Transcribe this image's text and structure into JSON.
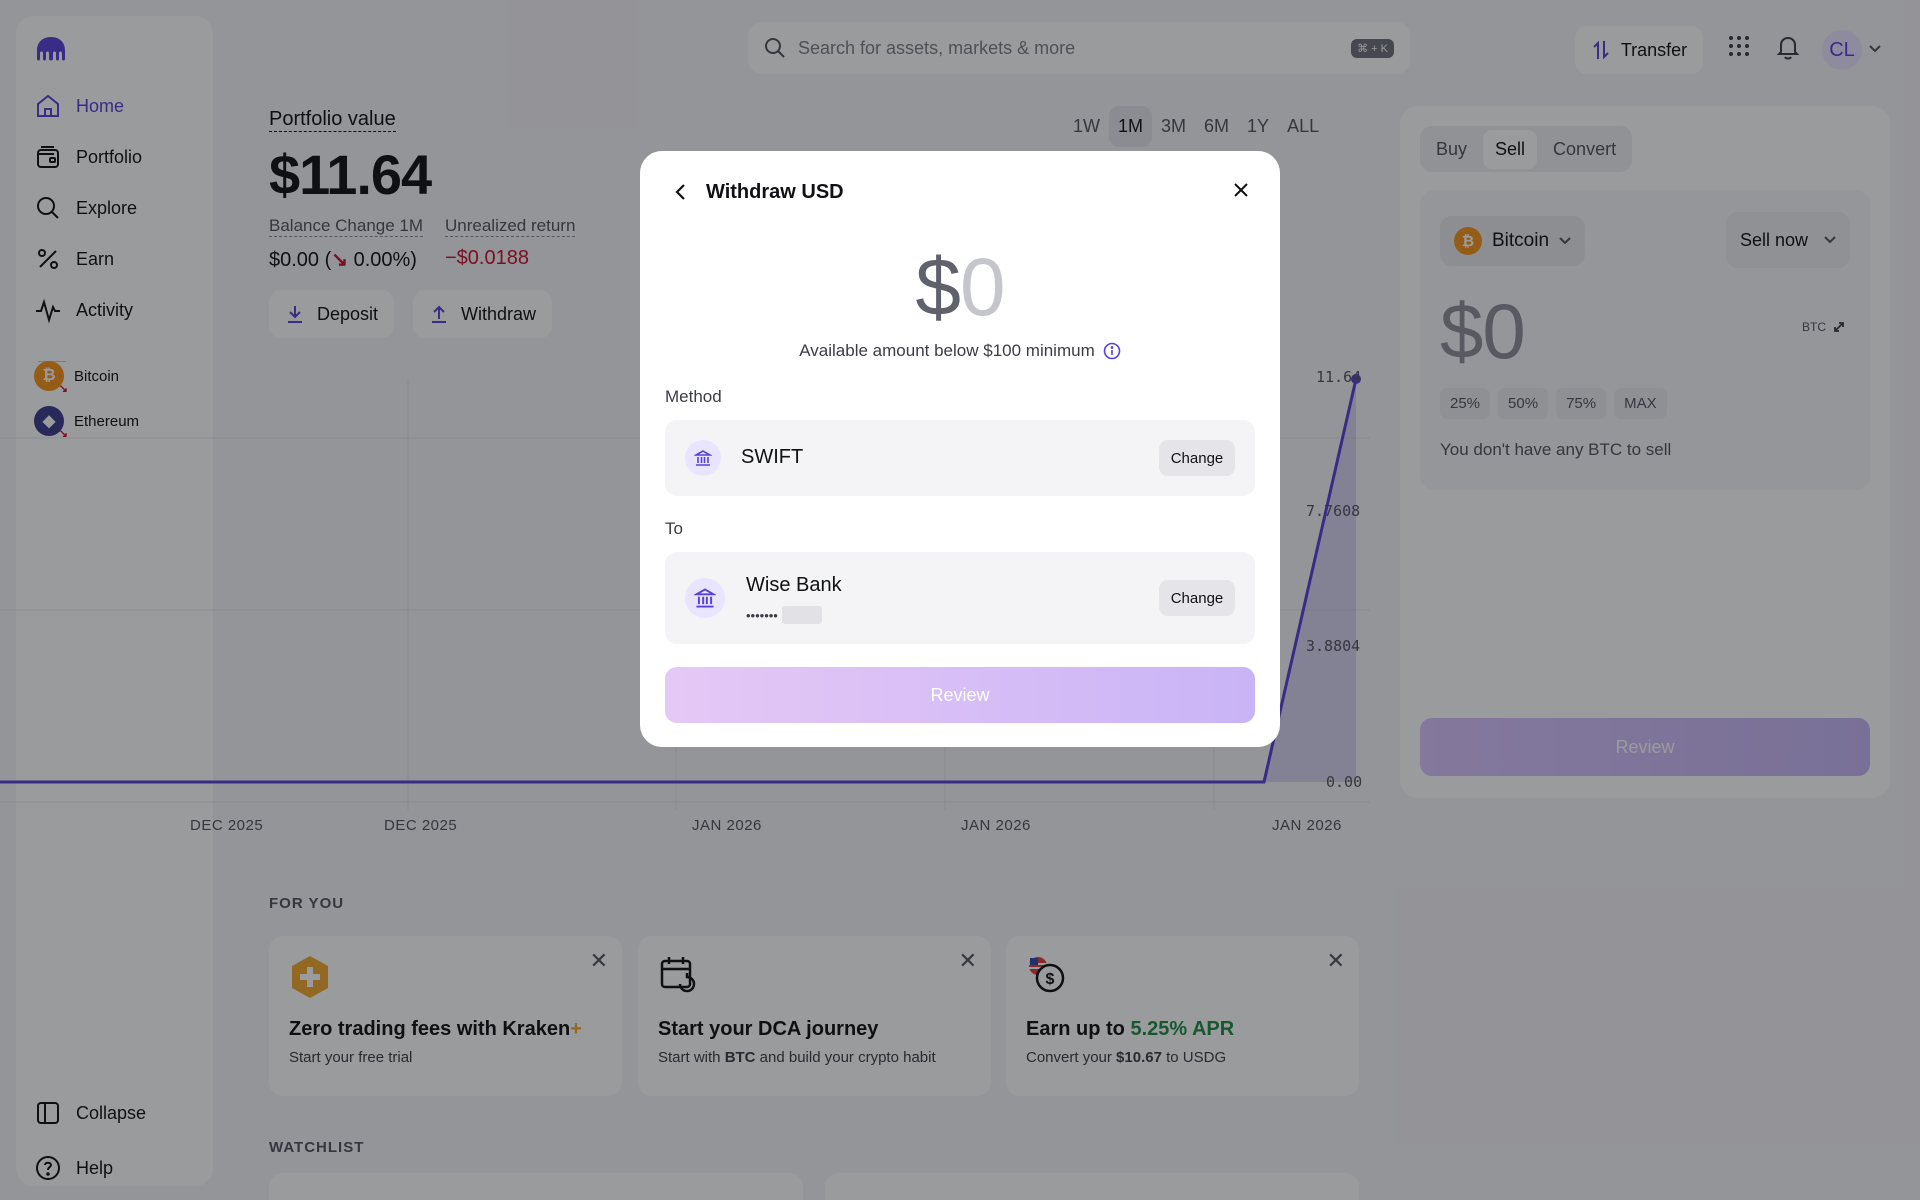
{
  "sidebar": {
    "items": [
      {
        "label": "Home",
        "icon": "home-icon"
      },
      {
        "label": "Portfolio",
        "icon": "wallet-icon"
      },
      {
        "label": "Explore",
        "icon": "search-icon"
      },
      {
        "label": "Earn",
        "icon": "percent-icon"
      },
      {
        "label": "Activity",
        "icon": "activity-icon"
      }
    ],
    "assets": [
      {
        "label": "Bitcoin",
        "color": "#f7931a"
      },
      {
        "label": "Ethereum",
        "color": "#3c3c8c"
      }
    ],
    "collapse_label": "Collapse",
    "help_label": "Help",
    "accent": "#5741d9"
  },
  "topbar": {
    "search_placeholder": "Search for assets, markets & more",
    "shortcut": "⌘ + K",
    "transfer_label": "Transfer",
    "avatar_initials": "CL"
  },
  "portfolio": {
    "label": "Portfolio value",
    "value": "$11.64",
    "balance_change_label": "Balance Change 1M",
    "balance_change_value": "$0.00 (",
    "balance_change_arrow": "↘",
    "balance_change_pct": "0.00%)",
    "unrealized_label": "Unrealized return",
    "unrealized_value": "−$0.0188",
    "deposit_label": "Deposit",
    "withdraw_label": "Withdraw",
    "periods": [
      "1W",
      "1M",
      "3M",
      "6M",
      "1Y",
      "ALL"
    ],
    "selected_period": "1M"
  },
  "chart_data": {
    "type": "line",
    "x": [
      "DEC 2025",
      "DEC 2025",
      "JAN 2026",
      "JAN 2026",
      "JAN 2026"
    ],
    "y_ticks": [
      "11.64",
      "7.7608",
      "3.8804",
      "0.00"
    ],
    "x_ticks": [
      "DEC 2025",
      "DEC 2025",
      "JAN 2026",
      "JAN 2026",
      "JAN 2026"
    ],
    "series": [
      {
        "values": [
          0,
          0,
          0,
          0,
          0,
          0,
          0,
          0,
          11.64
        ]
      }
    ],
    "ylim": [
      0,
      11.64
    ],
    "line_color": "#5741d9"
  },
  "for_you": {
    "heading": "FOR YOU",
    "cards": [
      {
        "title": "Zero trading fees with Kraken",
        "title_suffix": "+",
        "subtitle": "Start your free trial"
      },
      {
        "title": "Start your DCA journey",
        "subtitle_pre": "Start with ",
        "subtitle_bold": "BTC",
        "subtitle_post": " and build your crypto habit"
      },
      {
        "title_pre": "Earn up to ",
        "title_accent": "5.25% APR",
        "subtitle_pre": "Convert your ",
        "subtitle_bold": "$10.67",
        "subtitle_post": " to USDG"
      }
    ]
  },
  "watchlist": {
    "heading": "WATCHLIST"
  },
  "trade_panel": {
    "tabs": [
      "Buy",
      "Sell",
      "Convert"
    ],
    "selected_tab": "Sell",
    "asset": "Bitcoin",
    "order_type": "Sell now",
    "amount": "$0",
    "unit": "BTC",
    "percent_options": [
      "25%",
      "50%",
      "75%",
      "MAX"
    ],
    "notice": "You don't have any BTC to sell",
    "review_label": "Review"
  },
  "modal": {
    "title": "Withdraw USD",
    "amount_currency": "$",
    "amount_value": "0",
    "available_text": "Available amount below $100 minimum",
    "method_label": "Method",
    "method_value": "SWIFT",
    "to_label": "To",
    "bank_name": "Wise Bank",
    "bank_masked": "•••••••",
    "change_label": "Change",
    "review_label": "Review"
  }
}
